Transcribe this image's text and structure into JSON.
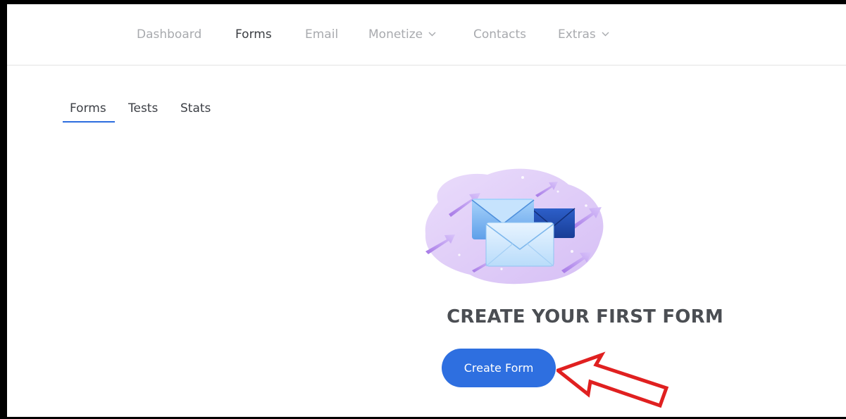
{
  "topnav": {
    "items": [
      {
        "label": "Dashboard",
        "active": false,
        "dropdown": false
      },
      {
        "label": "Forms",
        "active": true,
        "dropdown": false
      },
      {
        "label": "Email",
        "active": false,
        "dropdown": false
      },
      {
        "label": "Monetize",
        "active": false,
        "dropdown": true
      },
      {
        "label": "Contacts",
        "active": false,
        "dropdown": false
      },
      {
        "label": "Extras",
        "active": false,
        "dropdown": true
      }
    ]
  },
  "subtabs": {
    "items": [
      {
        "label": "Forms",
        "active": true
      },
      {
        "label": "Tests",
        "active": false
      },
      {
        "label": "Stats",
        "active": false
      }
    ]
  },
  "empty_state": {
    "heading": "CREATE YOUR FIRST FORM",
    "button_label": "Create Form",
    "illustration": "envelopes-illustration"
  },
  "colors": {
    "accent": "#2e6fe0",
    "annotation_arrow": "#e02020",
    "text_muted": "#a8aaae",
    "text_active": "#3a3d42"
  }
}
